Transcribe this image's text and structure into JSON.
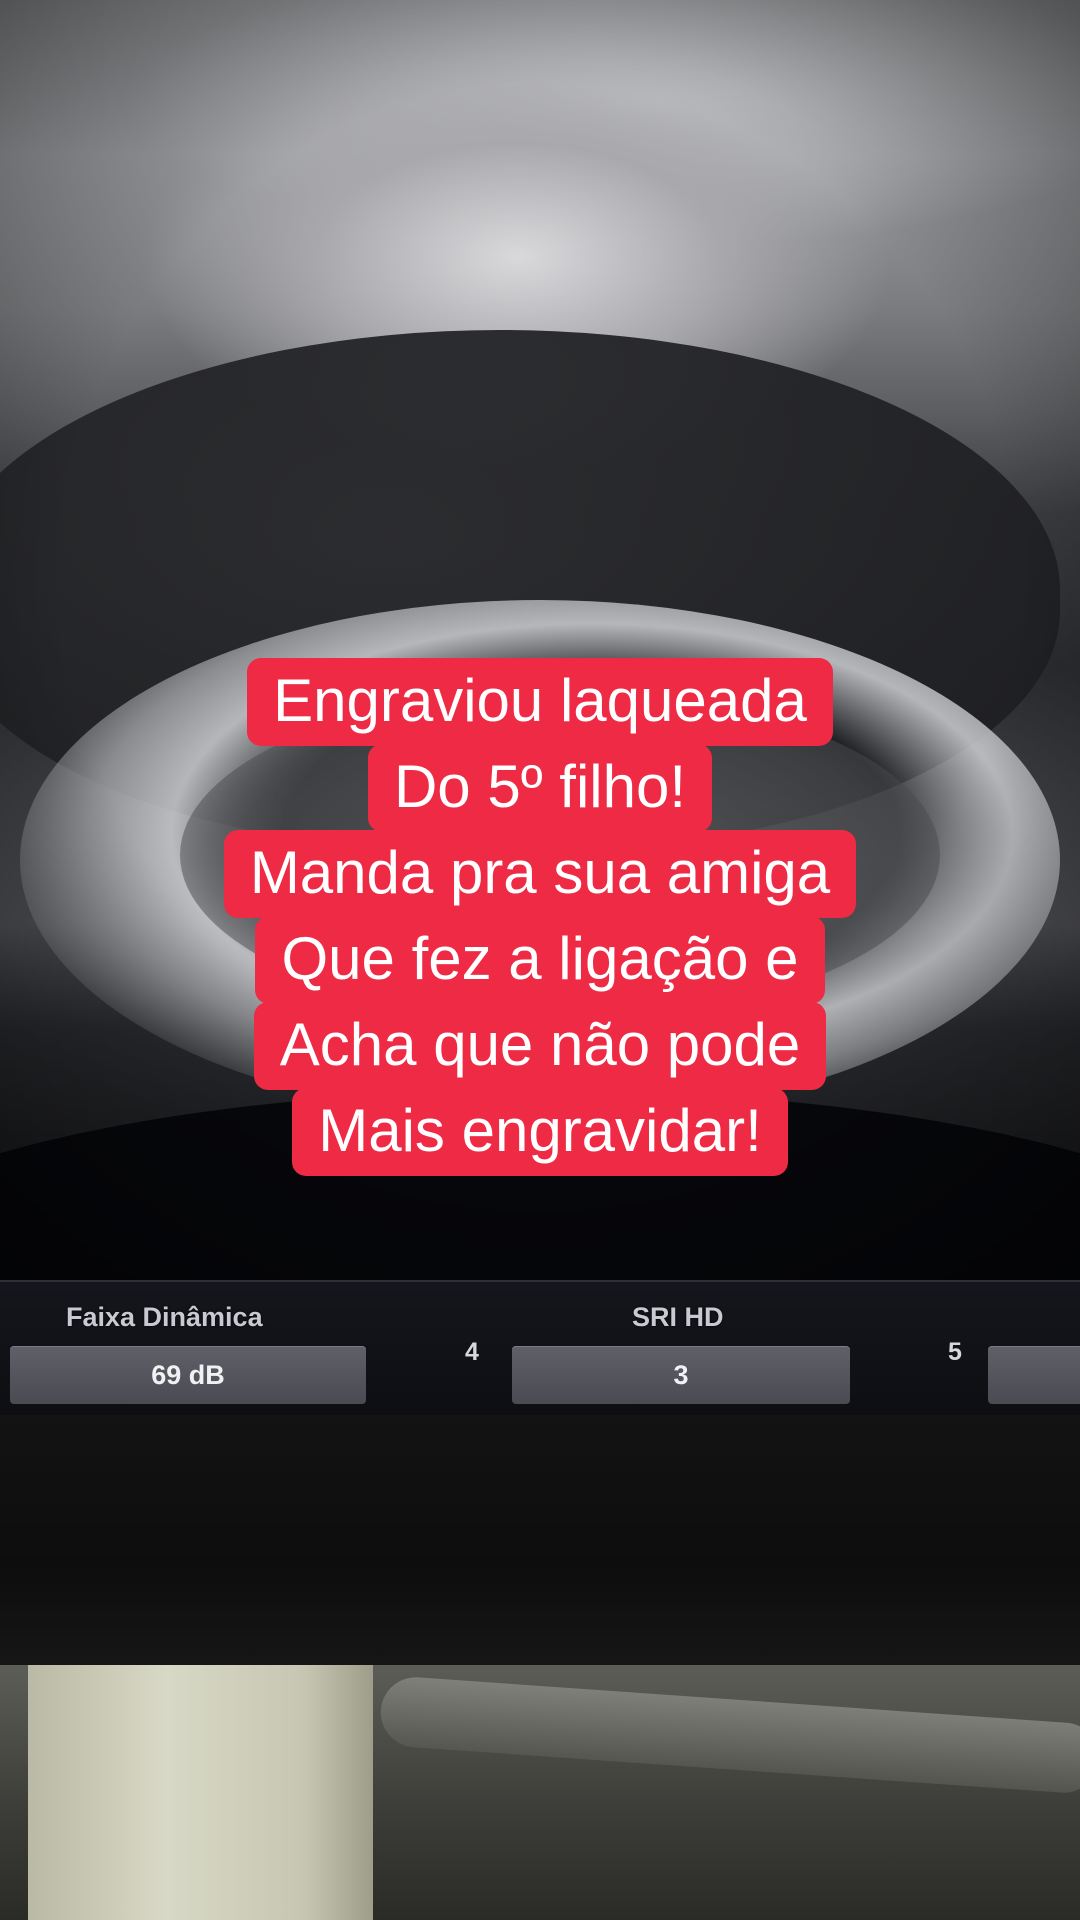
{
  "caption": {
    "lines": [
      "Engraviou laqueada",
      "Do 5º filho!",
      "Manda pra sua amiga",
      "Que fez a ligação e",
      "Acha que não pode",
      "Mais engravidar!"
    ],
    "background_color": "#ee2a44",
    "text_color": "#ffffff"
  },
  "controls": {
    "dynamic_range": {
      "label": "Faixa Dinâmica",
      "value": "69 dB"
    },
    "sri_hd": {
      "label": "SRI HD",
      "value": "3"
    },
    "knob_4": "4",
    "knob_5": "5"
  }
}
